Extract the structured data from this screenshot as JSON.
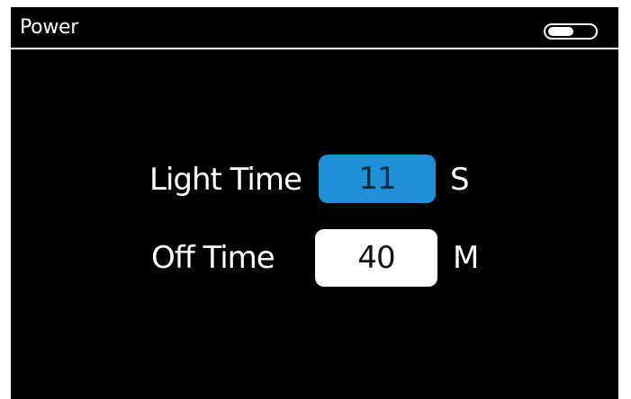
{
  "header": {
    "title": "Power",
    "battery_icon": "battery-icon"
  },
  "settings": [
    {
      "label": "Light Time",
      "value": "11",
      "unit": "S",
      "selected": true
    },
    {
      "label": "Off Time",
      "value": "40",
      "unit": "M",
      "selected": false
    }
  ],
  "colors": {
    "background": "#000000",
    "foreground": "#ffffff",
    "selected_field": "#1f8fd6",
    "field": "#ffffff"
  }
}
